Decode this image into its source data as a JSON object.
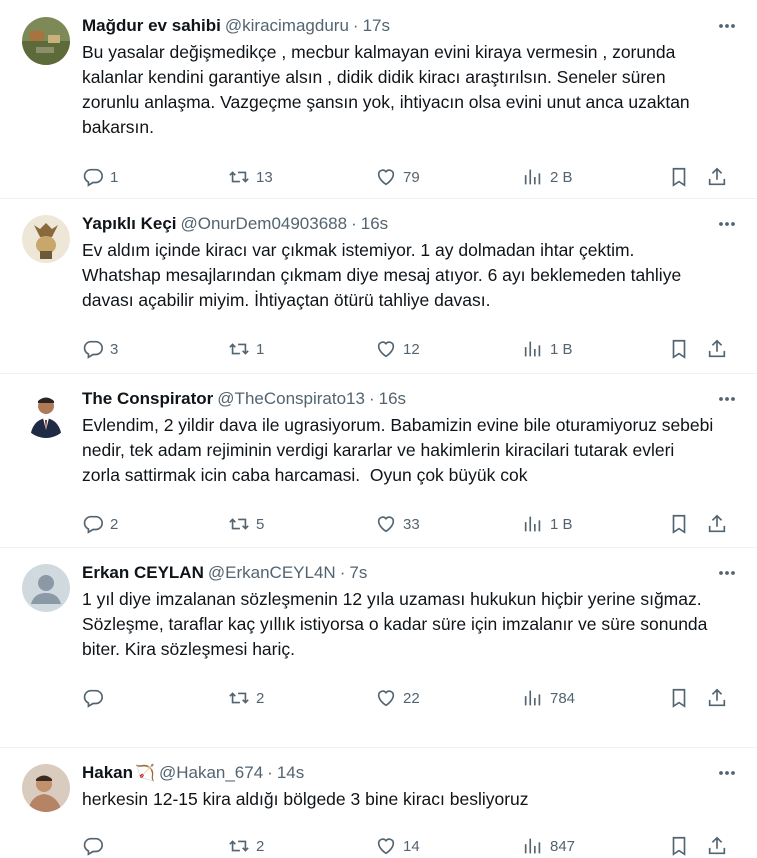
{
  "tweets": [
    {
      "name": "Mağdur ev sahibi",
      "handle": "@kiracimagduru",
      "time": "17s",
      "text": "Bu yasalar değişmedikçe , mecbur kalmayan evini kiraya vermesin , zorunda kalanlar kendini garantiye alsın , didik didik kiracı araştırılsın. Seneler süren zorunlu anlaşma. Vazgeçme şansın yok, ihtiyacın olsa evini unut anca uzaktan bakarsın.",
      "replies": "1",
      "retweets": "13",
      "likes": "79",
      "views": "2 B",
      "avatar_color": "#6d7a4a"
    },
    {
      "name": "Yapıklı Keçi",
      "handle": "@OnurDem04903688",
      "time": "16s",
      "text": "Ev aldım içinde kiracı var çıkmak istemiyor. 1 ay dolmadan ihtar çektim. Whatshap mesajlarından çıkmam diye mesaj atıyor. 6 ayı beklemeden tahliye davası açabilir miyim. İhtiyaçtan ötürü tahliye davası.",
      "replies": "3",
      "retweets": "1",
      "likes": "12",
      "views": "1 B",
      "avatar_color": "#e9e2d2"
    },
    {
      "name": "The Conspirator",
      "handle": "@TheConspirato13",
      "time": "16s",
      "text": "Evlendim, 2 yildir dava ile ugrasiyorum. Babamizin evine bile oturamiyoruz sebebi nedir, tek adam rejiminin verdigi kararlar ve hakimlerin kiracilari tutarak evleri zorla sattirmak icin caba harcamasi.  Oyun çok büyük cok",
      "replies": "2",
      "retweets": "5",
      "likes": "33",
      "views": "1 B",
      "avatar_color": "#ffffff"
    },
    {
      "name": "Erkan CEYLAN",
      "handle": "@ErkanCEYL4N",
      "time": "7s",
      "text": "1 yıl diye imzalanan sözleşmenin 12 yıla uzaması hukukun hiçbir yerine sığmaz.\nSözleşme, taraflar kaç yıllık istiyorsa o kadar süre için imzalanır ve süre sonunda biter. Kira sözleşmesi hariç.",
      "replies": "",
      "retweets": "2",
      "likes": "22",
      "views": "784",
      "avatar_color": "#cfd9de"
    },
    {
      "name": "Hakan",
      "name_emoji": "🏹",
      "handle": "@Hakan_674",
      "time": "14s",
      "text": "herkesin 12-15 kira aldığı bölgede 3 bine kiracı besliyoruz",
      "replies": "",
      "retweets": "2",
      "likes": "14",
      "views": "847",
      "avatar_color": "#b89c86"
    }
  ],
  "dot": "·",
  "icons": {
    "reply": "reply-icon",
    "retweet": "retweet-icon",
    "like": "heart-icon",
    "views": "views-icon",
    "bookmark": "bookmark-icon",
    "share": "share-icon",
    "more": "more-icon"
  },
  "colors": {
    "text": "#0f1419",
    "muted": "#536471",
    "divider": "#eff3f4"
  }
}
